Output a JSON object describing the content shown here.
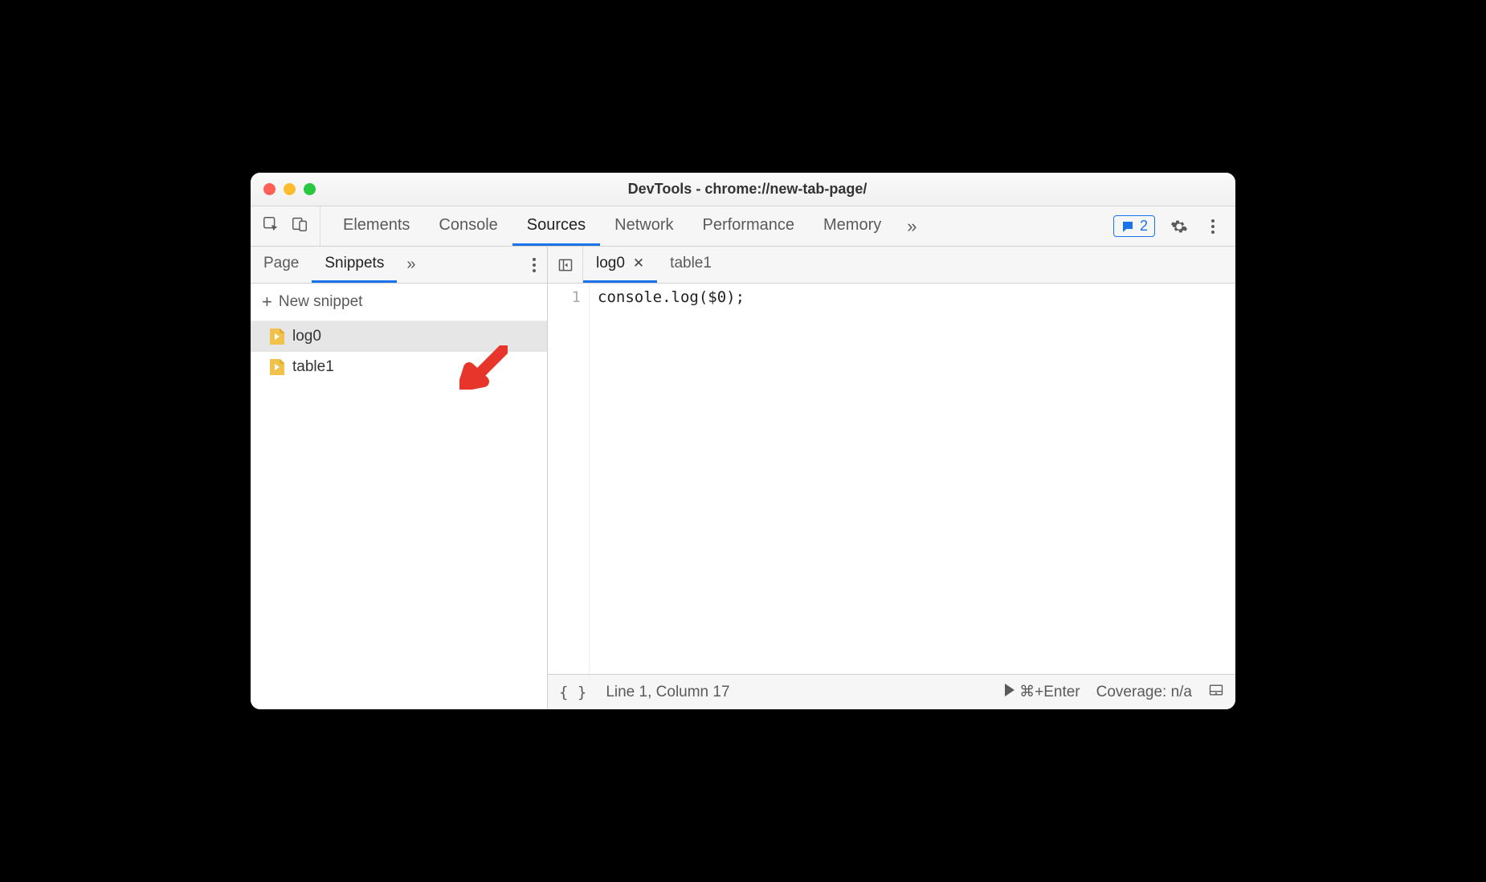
{
  "window": {
    "title": "DevTools - chrome://new-tab-page/"
  },
  "main_tabs": {
    "items": [
      "Elements",
      "Console",
      "Sources",
      "Network",
      "Performance",
      "Memory"
    ],
    "active_index": 2
  },
  "issues_badge": {
    "count": "2"
  },
  "sidebar_tabs": {
    "items": [
      "Page",
      "Snippets"
    ],
    "active_index": 1
  },
  "new_snippet_label": "New snippet",
  "snippets": {
    "items": [
      {
        "name": "log0",
        "selected": true
      },
      {
        "name": "table1",
        "selected": false
      }
    ]
  },
  "editor_tabs": {
    "items": [
      {
        "label": "log0",
        "active": true,
        "closeable": true
      },
      {
        "label": "table1",
        "active": false,
        "closeable": false
      }
    ]
  },
  "code": {
    "lines": [
      {
        "n": "1",
        "text": "console.log($0);"
      }
    ]
  },
  "statusbar": {
    "position": "Line 1, Column 17",
    "run_hint": "⌘+Enter",
    "coverage": "Coverage: n/a"
  }
}
